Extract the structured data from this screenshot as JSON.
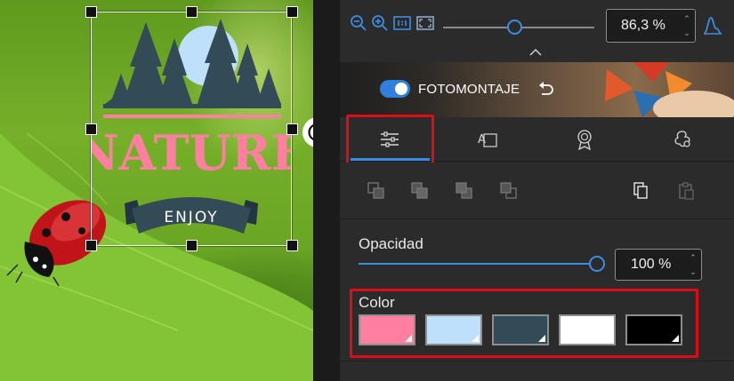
{
  "canvas": {
    "sticker": {
      "title": "NATURE",
      "ribbon": "ENJOY"
    }
  },
  "zoom": {
    "value": "86,3 %",
    "slider_level": 0.47,
    "icons": [
      "zoom-out-icon",
      "zoom-in-icon",
      "actual-size-icon",
      "fit-screen-icon",
      "histogram-icon"
    ]
  },
  "banner": {
    "toggle_on": true,
    "label": "FOTOMONTAJE"
  },
  "tabs": [
    {
      "name": "adjustments",
      "icon": "sliders-icon",
      "active": true
    },
    {
      "name": "text",
      "icon": "text-box-icon",
      "active": false
    },
    {
      "name": "badges",
      "icon": "award-icon",
      "active": false
    },
    {
      "name": "clipart",
      "icon": "shapes-icon",
      "active": false
    }
  ],
  "opacity": {
    "label": "Opacidad",
    "value": "100 %",
    "level": 1.0
  },
  "color": {
    "label": "Color",
    "swatches": [
      "#ff7fa0",
      "#bfe0fb",
      "#334a57",
      "#ffffff",
      "#000000"
    ]
  },
  "colors": {
    "accent": "#3b8de0",
    "highlight": "#e20a16"
  }
}
